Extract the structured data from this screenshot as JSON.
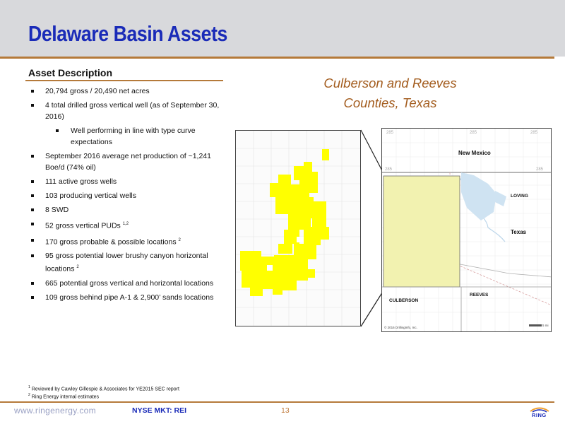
{
  "slide": {
    "title": "Delaware Basin Assets",
    "page_number": "13"
  },
  "asset_description": {
    "heading": "Asset Description",
    "bullets": [
      {
        "text": "20,794 gross / 20,490 net acres"
      },
      {
        "text": "4 total drilled gross vertical well (as of September 30, 2016)"
      },
      {
        "text": "Well performing in line with type curve expectations"
      },
      {
        "text": "September 2016 average net production of ~1,241 Boe/d (74% oil)"
      },
      {
        "text": "111 active gross wells"
      },
      {
        "text": "103 producing vertical wells"
      },
      {
        "text": "8 SWD"
      },
      {
        "text": "52 gross vertical PUDs",
        "sup": "1,2"
      },
      {
        "text": "170 gross probable & possible locations",
        "sup": "2"
      },
      {
        "text": "95 gross potential lower brushy canyon horizontal locations",
        "sup": "2"
      },
      {
        "text": "665 potential gross vertical and horizontal locations"
      },
      {
        "text": "109 gross behind pipe A-1 & 2,900’ sands locations"
      }
    ]
  },
  "map": {
    "title_line1": "Culberson and Reeves",
    "title_line2": "Counties, Texas",
    "labels": {
      "new_mexico": "New Mexico",
      "loving": "LOVING",
      "texas": "Texas",
      "reeves": "REEVES",
      "culberson": "CULBERSON",
      "copyright": "© 2016 DrillingInfo, Inc.",
      "scale": "5 mi",
      "road_top_left": "285",
      "road_top_mid": "285",
      "road_top_right": "285",
      "road_mid_left": "285",
      "road_mid_right": "285"
    },
    "colors": {
      "acreage": "#ffff00",
      "overlay": "#f2f2b0",
      "water": "#cfe3f2",
      "border": "#444444"
    }
  },
  "footnotes": {
    "note1_marker": "1",
    "note1": "Reviewed by Cawley Gillespie & Associates for YE2015 SEC report",
    "note2_marker": "2",
    "note2": "Ring Energy internal estimates"
  },
  "footer": {
    "url": "www.ringenergy.com",
    "ticker": "NYSE MKT: REI",
    "logo_text": "RING"
  },
  "colors": {
    "title_blue": "#1a2bb8",
    "accent_brown": "#b57a3a",
    "header_gray": "#d8d9dc"
  }
}
